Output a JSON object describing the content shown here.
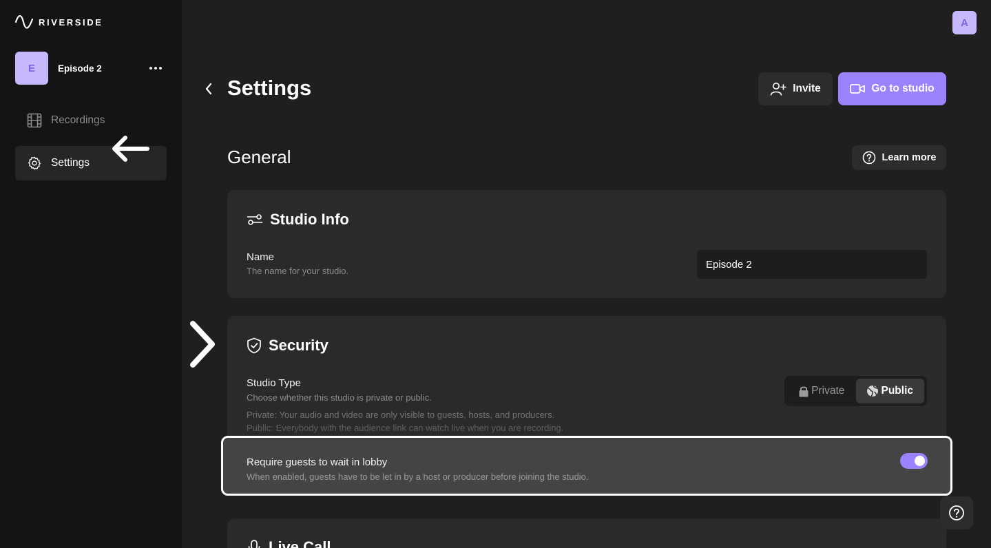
{
  "app": {
    "logo_text": "RIVERSIDE",
    "user_initial": "A"
  },
  "project": {
    "initial": "E",
    "name": "Episode 2"
  },
  "sidebar": {
    "items": [
      {
        "label": "Recordings"
      },
      {
        "label": "Settings"
      }
    ]
  },
  "header": {
    "title": "Settings",
    "invite_label": "Invite",
    "studio_label": "Go to studio"
  },
  "general": {
    "title": "General",
    "learn_more_label": "Learn more"
  },
  "studio_info": {
    "title": "Studio Info",
    "name_label": "Name",
    "name_desc": "The name for your studio.",
    "name_value": "Episode 2"
  },
  "security": {
    "title": "Security",
    "type_label": "Studio Type",
    "type_desc": "Choose whether this studio is private or public.",
    "private_desc": "Private: Your audio and video are only visible to guests, hosts, and producers.",
    "public_desc": "Public: Everybody with the audience link can watch live when you are recording.",
    "private_label": "Private",
    "public_label": "Public",
    "selected": "Public",
    "lobby_label": "Require guests to wait in lobby",
    "lobby_desc": "When enabled, guests have to be let in by a host or producer before joining the studio.",
    "lobby_enabled": true
  },
  "live_call": {
    "title": "Live Call"
  },
  "colors": {
    "accent": "#9c82ff",
    "avatar_bg": "#c7b8fb",
    "sidebar_bg": "#141414",
    "main_bg": "#1f1f1f",
    "card_bg": "#2a2a2a"
  }
}
